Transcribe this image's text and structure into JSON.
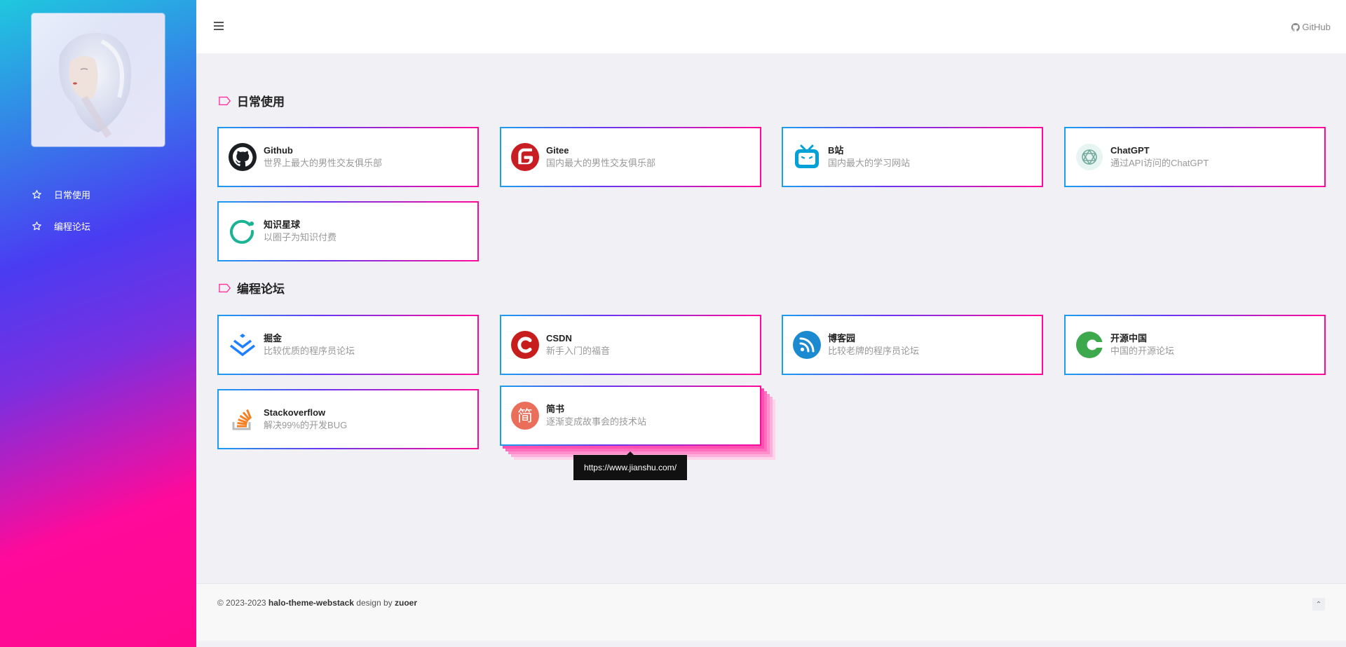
{
  "sidebar": {
    "items": [
      {
        "label": "日常使用",
        "icon": "star-icon"
      },
      {
        "label": "编程论坛",
        "icon": "star-icon"
      }
    ]
  },
  "header": {
    "github_label": "GitHub"
  },
  "sections": [
    {
      "title": "日常使用",
      "cards": [
        {
          "name": "Github",
          "desc": "世界上最大的男性交友俱乐部",
          "icon": "github-icon"
        },
        {
          "name": "Gitee",
          "desc": "国内最大的男性交友俱乐部",
          "icon": "gitee-icon"
        },
        {
          "name": "B站",
          "desc": "国内最大的学习网站",
          "icon": "bilibili-icon"
        },
        {
          "name": "ChatGPT",
          "desc": "通过API访问的ChatGPT",
          "icon": "chatgpt-icon"
        },
        {
          "name": "知识星球",
          "desc": "以圈子为知识付费",
          "icon": "zsxq-icon"
        }
      ]
    },
    {
      "title": "编程论坛",
      "cards": [
        {
          "name": "掘金",
          "desc": "比较优质的程序员论坛",
          "icon": "juejin-icon"
        },
        {
          "name": "CSDN",
          "desc": "新手入门的福音",
          "icon": "csdn-icon"
        },
        {
          "name": "博客园",
          "desc": "比较老牌的程序员论坛",
          "icon": "cnblogs-icon"
        },
        {
          "name": "开源中国",
          "desc": "中国的开源论坛",
          "icon": "oschina-icon"
        },
        {
          "name": "Stackoverflow",
          "desc": "解决99%的开发BUG",
          "icon": "stackoverflow-icon"
        },
        {
          "name": "简书",
          "desc": "逐渐变成故事会的技术站",
          "icon": "jianshu-icon"
        }
      ]
    }
  ],
  "tooltip": "https://www.jianshu.com/",
  "footer": {
    "prefix": "© 2023-2023 ",
    "theme": "halo-theme-webstack",
    "middle": " design by ",
    "author": "zuoer"
  },
  "colors": {
    "accent": "#ff0a9a",
    "sidebar_top": "#1fc8de",
    "sidebar_mid": "#4a3cf2",
    "sidebar_bottom": "#ff0a8e"
  }
}
